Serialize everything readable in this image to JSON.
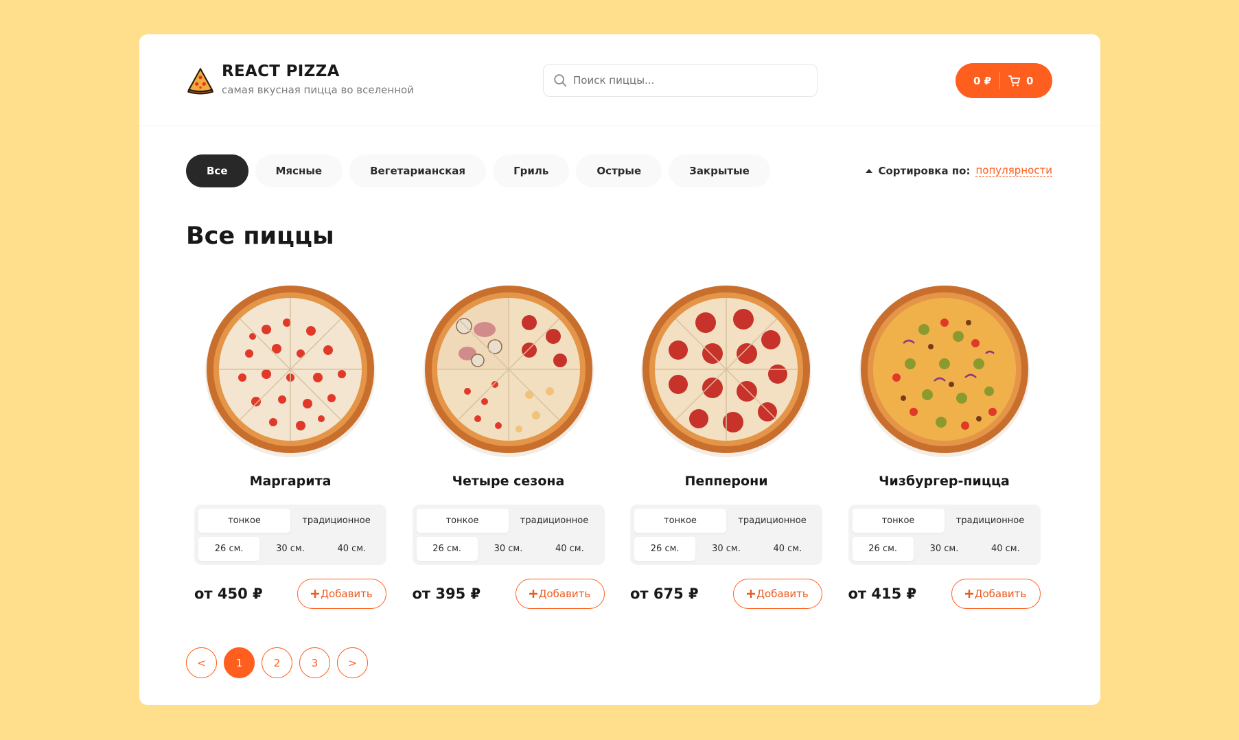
{
  "header": {
    "logo_title": "REACT PIZZA",
    "logo_subtitle": "самая вкусная пицца во вселенной",
    "search_placeholder": "Поиск пиццы...",
    "cart_total": "0 ₽",
    "cart_count": "0",
    "accent_color": "#fe5f1e"
  },
  "categories": {
    "items": [
      "Все",
      "Мясные",
      "Вегетарианская",
      "Гриль",
      "Острые",
      "Закрытые"
    ],
    "active": "Все"
  },
  "sort": {
    "label": "Сортировка по:",
    "value": "популярности"
  },
  "page_title": "Все пиццы",
  "pizzas": [
    {
      "title": "Маргарита",
      "types": [
        "тонкое",
        "традиционное"
      ],
      "selected_type": "тонкое",
      "sizes": [
        "26 см.",
        "30 см.",
        "40 см."
      ],
      "selected_size": "26 см.",
      "price": "от 450 ₽",
      "add_label": "Добавить"
    },
    {
      "title": "Четыре сезона",
      "types": [
        "тонкое",
        "традиционное"
      ],
      "selected_type": "тонкое",
      "sizes": [
        "26 см.",
        "30 см.",
        "40 см."
      ],
      "selected_size": "26 см.",
      "price": "от 395 ₽",
      "add_label": "Добавить"
    },
    {
      "title": "Пепперони",
      "types": [
        "тонкое",
        "традиционное"
      ],
      "selected_type": "тонкое",
      "sizes": [
        "26 см.",
        "30 см.",
        "40 см."
      ],
      "selected_size": "26 см.",
      "price": "от 675 ₽",
      "add_label": "Добавить"
    },
    {
      "title": "Чизбургер-пицца",
      "types": [
        "тонкое",
        "традиционное"
      ],
      "selected_type": "тонкое",
      "sizes": [
        "26 см.",
        "30 см.",
        "40 см."
      ],
      "selected_size": "26 см.",
      "price": "от 415 ₽",
      "add_label": "Добавить"
    }
  ],
  "pagination": {
    "prev": "<",
    "pages": [
      "1",
      "2",
      "3"
    ],
    "current": "1",
    "next": ">"
  }
}
